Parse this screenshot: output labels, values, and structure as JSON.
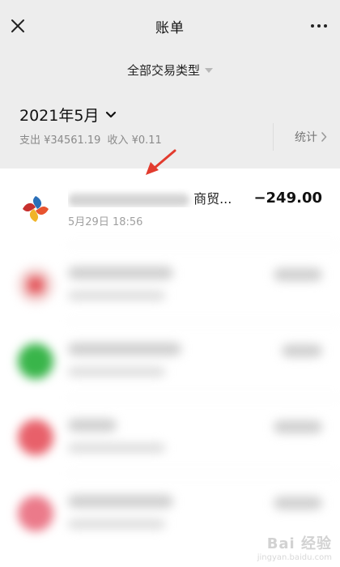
{
  "header": {
    "title": "账单",
    "close_icon": "close-icon",
    "more_icon": "more-dots-icon"
  },
  "filter": {
    "label": "全部交易类型",
    "icon": "caret-down-icon"
  },
  "month": {
    "label": "2021年5月",
    "icon": "chevron-down-icon"
  },
  "summary": {
    "expense": "支出 ¥34561.19",
    "income": "收入 ¥0.11"
  },
  "stats": {
    "label": "统计",
    "icon": "chevron-right-icon"
  },
  "transactions": [
    {
      "merchant": "商贸...",
      "datetime": "5月29日 18:56",
      "amount": "−249.00",
      "icon_color": "#e8542f",
      "blurred": false
    },
    {
      "blurred": true,
      "icon_color": "#e4575c"
    },
    {
      "blurred": true,
      "icon_color": "#39b54a"
    },
    {
      "blurred": true,
      "icon_color": "#e8606a"
    },
    {
      "blurred": true,
      "icon_color": "#eb7a8a"
    }
  ],
  "annotation": {
    "arrow_color": "#e23b2e"
  },
  "watermark": {
    "main": "Bai 经验",
    "sub": "jingyan.baidu.com"
  },
  "colors": {
    "background": "#ededed",
    "list_background": "#ffffff",
    "secondary_text": "#8a8a8a"
  }
}
